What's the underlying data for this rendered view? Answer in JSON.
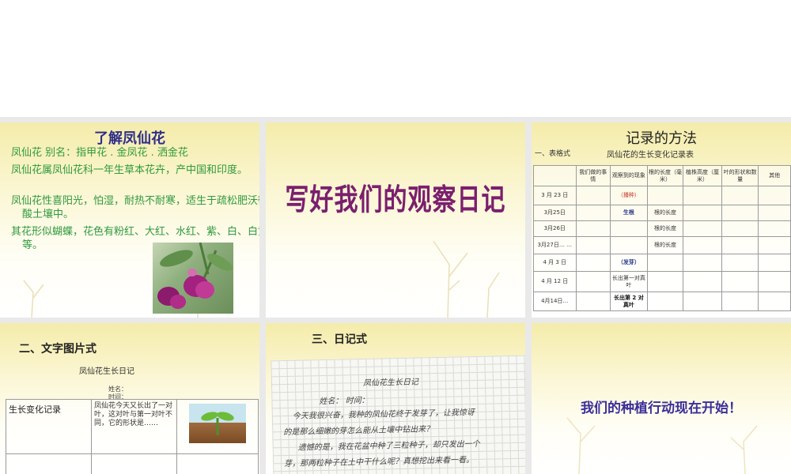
{
  "slide1": {
    "title": "了解凤仙花",
    "p1": "凤仙花  别名：指甲花 . 金凤花 . 洒金花",
    "p2": "凤仙花属凤仙花科一年生草本花卉，产中国和印度。",
    "p3": "凤仙花性喜阳光，怕湿，耐热不耐寒，适生于疏松肥沃微酸土壤中。",
    "p4": "其花形似蝴蝶，花色有粉红、大红、水红、紫、白、白黄等。"
  },
  "slide2": {
    "title": "写好我们的观察日记"
  },
  "slide3": {
    "title": "记录的方法",
    "sub1": "一、表格式",
    "sub2": "凤仙花的生长变化记录表",
    "headers": [
      "",
      "我们做的事情",
      "观察到的现象",
      "根的长度（毫米）",
      "植株高度（厘米）",
      "叶的形状和数量",
      "其他"
    ],
    "rows": [
      [
        "3 月 23 日",
        "",
        "（播种）",
        "",
        "",
        "",
        ""
      ],
      [
        "3月25日",
        "",
        "生根",
        "根的长度",
        "",
        "",
        ""
      ],
      [
        "3月26日",
        "",
        "",
        "根的长度",
        "",
        "",
        ""
      ],
      [
        "3月27日…\n…",
        "",
        "",
        "根的长度",
        "",
        "",
        ""
      ],
      [
        "4 月 3 日",
        "",
        "（发芽）",
        "",
        "",
        "",
        ""
      ],
      [
        "4 月 12 日",
        "",
        "长出第一对真叶",
        "",
        "",
        "",
        ""
      ],
      [
        "4月14日…",
        "",
        "长出第 2 对真叶",
        "",
        "",
        "",
        ""
      ]
    ]
  },
  "slide4": {
    "heading": "二、文字图片式",
    "caption": "凤仙花生长日记",
    "name_label": "姓名：",
    "time_label": "时间：",
    "cell_label": "生长变化记录",
    "cell_text": "凤仙花今天又长出了一对叶，这对叶与第一对叶不同，它的形状是……"
  },
  "slide5": {
    "heading": "三、日记式",
    "diary_title": "凤仙花生长日记",
    "diary_meta": "姓名：        时间：",
    "line1": "今天我很兴奋，我种的凤仙花终于发芽了，让我惊讶",
    "line2": "的是那么细嫩的芽怎么能从土壤中钻出来？",
    "line3": "遗憾的是，我在花盆中种了三粒种子，却只发出一个",
    "line4": "芽，那两粒种子在土中干什么呢？真想挖出来看一看。"
  },
  "slide6": {
    "message": "我们的种植行动现在开始！"
  },
  "colors": {
    "title_blue": "#2e2e8a",
    "green_text": "#2f9a3e",
    "art_title": "#7a1f6e",
    "slide_bg": "#f4ecaa"
  }
}
